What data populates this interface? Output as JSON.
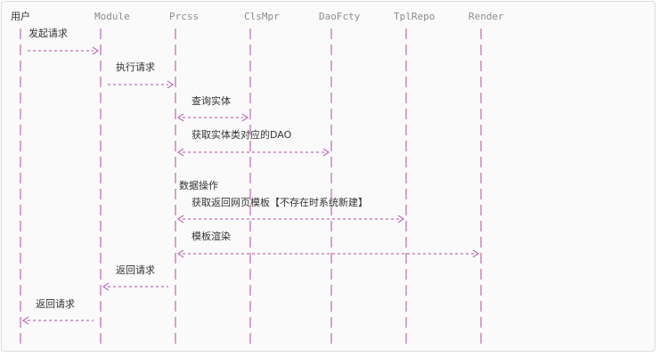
{
  "participants": [
    "用户",
    "Module",
    "Prcss",
    "ClsMpr",
    "DaoFcty",
    "TplRepo",
    "Render"
  ],
  "messages": [
    {
      "label": "发起请求",
      "from": "用户",
      "to": "Module",
      "direction": "right"
    },
    {
      "label": "执行请求",
      "from": "Module",
      "to": "Prcss",
      "direction": "right"
    },
    {
      "label": "查询实体",
      "from": "Prcss",
      "to": "ClsMpr",
      "direction": "both"
    },
    {
      "label": "获取实体类对应的DAO",
      "from": "Prcss",
      "to": "DaoFcty",
      "direction": "both"
    },
    {
      "label": "数据操作",
      "from": "Prcss",
      "to": "Prcss",
      "direction": "self"
    },
    {
      "label": "获取返回网页模板【不存在时系统新建】",
      "from": "Prcss",
      "to": "TplRepo",
      "direction": "both"
    },
    {
      "label": "模板渲染",
      "from": "Prcss",
      "to": "Render",
      "direction": "both"
    },
    {
      "label": "返回请求",
      "from": "Prcss",
      "to": "Module",
      "direction": "left"
    },
    {
      "label": "返回请求",
      "from": "Module",
      "to": "用户",
      "direction": "left"
    }
  ],
  "colors": {
    "line": "#b04aa8",
    "text": "#333333",
    "participant": "#8b8b8b",
    "background": "#fafafa",
    "border": "#dcdcdc"
  }
}
